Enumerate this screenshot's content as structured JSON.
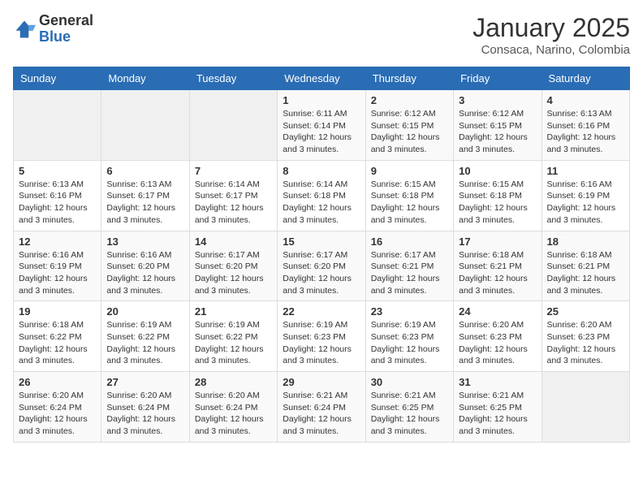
{
  "header": {
    "logo_general": "General",
    "logo_blue": "Blue",
    "month_title": "January 2025",
    "subtitle": "Consaca, Narino, Colombia"
  },
  "weekdays": [
    "Sunday",
    "Monday",
    "Tuesday",
    "Wednesday",
    "Thursday",
    "Friday",
    "Saturday"
  ],
  "weeks": [
    [
      {
        "day": "",
        "info": ""
      },
      {
        "day": "",
        "info": ""
      },
      {
        "day": "",
        "info": ""
      },
      {
        "day": "1",
        "info": "Sunrise: 6:11 AM\nSunset: 6:14 PM\nDaylight: 12 hours and 3 minutes."
      },
      {
        "day": "2",
        "info": "Sunrise: 6:12 AM\nSunset: 6:15 PM\nDaylight: 12 hours and 3 minutes."
      },
      {
        "day": "3",
        "info": "Sunrise: 6:12 AM\nSunset: 6:15 PM\nDaylight: 12 hours and 3 minutes."
      },
      {
        "day": "4",
        "info": "Sunrise: 6:13 AM\nSunset: 6:16 PM\nDaylight: 12 hours and 3 minutes."
      }
    ],
    [
      {
        "day": "5",
        "info": "Sunrise: 6:13 AM\nSunset: 6:16 PM\nDaylight: 12 hours and 3 minutes."
      },
      {
        "day": "6",
        "info": "Sunrise: 6:13 AM\nSunset: 6:17 PM\nDaylight: 12 hours and 3 minutes."
      },
      {
        "day": "7",
        "info": "Sunrise: 6:14 AM\nSunset: 6:17 PM\nDaylight: 12 hours and 3 minutes."
      },
      {
        "day": "8",
        "info": "Sunrise: 6:14 AM\nSunset: 6:18 PM\nDaylight: 12 hours and 3 minutes."
      },
      {
        "day": "9",
        "info": "Sunrise: 6:15 AM\nSunset: 6:18 PM\nDaylight: 12 hours and 3 minutes."
      },
      {
        "day": "10",
        "info": "Sunrise: 6:15 AM\nSunset: 6:18 PM\nDaylight: 12 hours and 3 minutes."
      },
      {
        "day": "11",
        "info": "Sunrise: 6:16 AM\nSunset: 6:19 PM\nDaylight: 12 hours and 3 minutes."
      }
    ],
    [
      {
        "day": "12",
        "info": "Sunrise: 6:16 AM\nSunset: 6:19 PM\nDaylight: 12 hours and 3 minutes."
      },
      {
        "day": "13",
        "info": "Sunrise: 6:16 AM\nSunset: 6:20 PM\nDaylight: 12 hours and 3 minutes."
      },
      {
        "day": "14",
        "info": "Sunrise: 6:17 AM\nSunset: 6:20 PM\nDaylight: 12 hours and 3 minutes."
      },
      {
        "day": "15",
        "info": "Sunrise: 6:17 AM\nSunset: 6:20 PM\nDaylight: 12 hours and 3 minutes."
      },
      {
        "day": "16",
        "info": "Sunrise: 6:17 AM\nSunset: 6:21 PM\nDaylight: 12 hours and 3 minutes."
      },
      {
        "day": "17",
        "info": "Sunrise: 6:18 AM\nSunset: 6:21 PM\nDaylight: 12 hours and 3 minutes."
      },
      {
        "day": "18",
        "info": "Sunrise: 6:18 AM\nSunset: 6:21 PM\nDaylight: 12 hours and 3 minutes."
      }
    ],
    [
      {
        "day": "19",
        "info": "Sunrise: 6:18 AM\nSunset: 6:22 PM\nDaylight: 12 hours and 3 minutes."
      },
      {
        "day": "20",
        "info": "Sunrise: 6:19 AM\nSunset: 6:22 PM\nDaylight: 12 hours and 3 minutes."
      },
      {
        "day": "21",
        "info": "Sunrise: 6:19 AM\nSunset: 6:22 PM\nDaylight: 12 hours and 3 minutes."
      },
      {
        "day": "22",
        "info": "Sunrise: 6:19 AM\nSunset: 6:23 PM\nDaylight: 12 hours and 3 minutes."
      },
      {
        "day": "23",
        "info": "Sunrise: 6:19 AM\nSunset: 6:23 PM\nDaylight: 12 hours and 3 minutes."
      },
      {
        "day": "24",
        "info": "Sunrise: 6:20 AM\nSunset: 6:23 PM\nDaylight: 12 hours and 3 minutes."
      },
      {
        "day": "25",
        "info": "Sunrise: 6:20 AM\nSunset: 6:23 PM\nDaylight: 12 hours and 3 minutes."
      }
    ],
    [
      {
        "day": "26",
        "info": "Sunrise: 6:20 AM\nSunset: 6:24 PM\nDaylight: 12 hours and 3 minutes."
      },
      {
        "day": "27",
        "info": "Sunrise: 6:20 AM\nSunset: 6:24 PM\nDaylight: 12 hours and 3 minutes."
      },
      {
        "day": "28",
        "info": "Sunrise: 6:20 AM\nSunset: 6:24 PM\nDaylight: 12 hours and 3 minutes."
      },
      {
        "day": "29",
        "info": "Sunrise: 6:21 AM\nSunset: 6:24 PM\nDaylight: 12 hours and 3 minutes."
      },
      {
        "day": "30",
        "info": "Sunrise: 6:21 AM\nSunset: 6:25 PM\nDaylight: 12 hours and 3 minutes."
      },
      {
        "day": "31",
        "info": "Sunrise: 6:21 AM\nSunset: 6:25 PM\nDaylight: 12 hours and 3 minutes."
      },
      {
        "day": "",
        "info": ""
      }
    ]
  ]
}
